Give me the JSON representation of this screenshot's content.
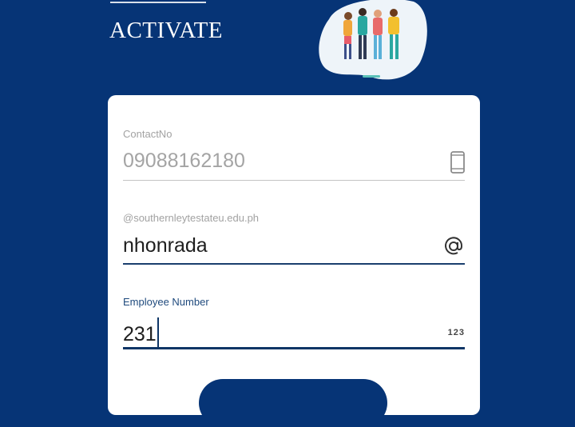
{
  "header": {
    "title": "ACTIVATE",
    "illustration_icon": "people-group-illustration"
  },
  "form": {
    "contact": {
      "label": "ContactNo",
      "value": "09088162180",
      "icon": "mobile-phone-icon"
    },
    "email": {
      "label": "@southernleytestateu.edu.ph",
      "value": "nhonrada",
      "icon": "at-sign-icon"
    },
    "employee": {
      "label": "Employee Number",
      "value": "231",
      "icon_text": "123"
    }
  },
  "colors": {
    "background": "#063476",
    "card": "#ffffff",
    "active_underline": "#0e3566"
  }
}
